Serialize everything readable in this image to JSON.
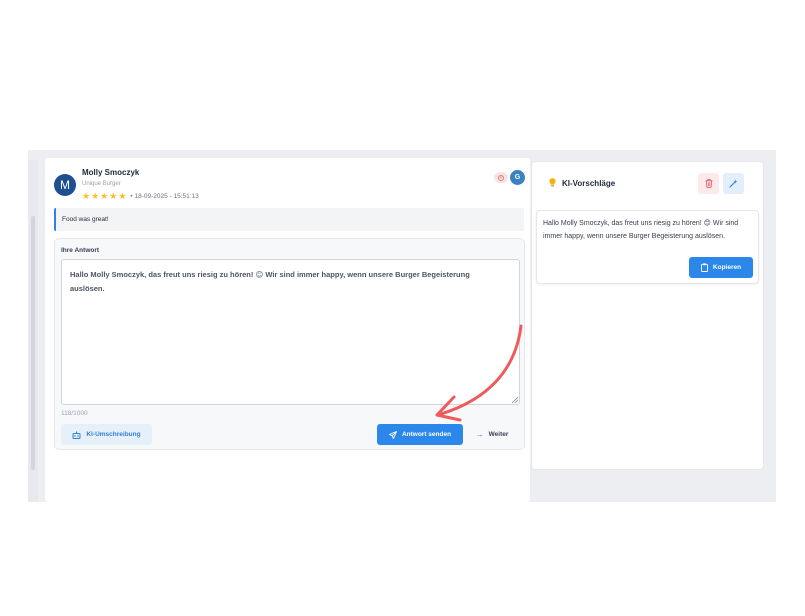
{
  "review": {
    "avatar_letter": "M",
    "reviewer_name": "Molly Smoczyk",
    "business_name": "Unique Burger",
    "stars": [
      "★",
      "★",
      "★",
      "★",
      "★"
    ],
    "rating": 5,
    "timestamp": "• 18-09-2025 - 15:51:13",
    "source_badge": "G",
    "text": "Food was great!"
  },
  "answer": {
    "label": "Ihre Antwort",
    "text": "Hallo Molly Smoczyk, das freut uns riesig zu hören! 😊 Wir sind immer happy, wenn unsere Burger Begeisterung auslösen.",
    "char_count": "118/1000",
    "ki_rewrite_label": "KI-Umschreibung",
    "send_label": "Antwort senden",
    "next_label": "Weiter"
  },
  "suggestions": {
    "title": "KI-Vorschläge",
    "items": [
      {
        "text": "Hallo Molly Smoczyk, das freut uns riesig zu hören! 😊 Wir sind immer happy, wenn unsere Burger Begeisterung auslösen.",
        "copy_label": "Kopieren"
      }
    ]
  },
  "colors": {
    "primary": "#2b88ea",
    "avatar": "#1e4f91",
    "star": "#fbbf24",
    "annotation_arrow": "#f05a5a"
  }
}
